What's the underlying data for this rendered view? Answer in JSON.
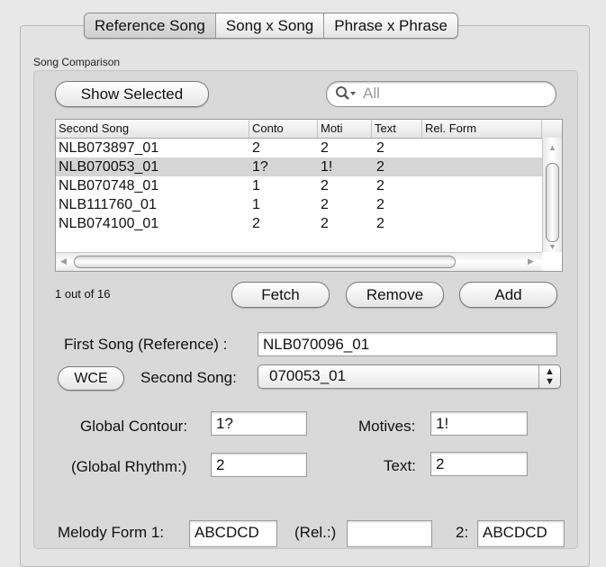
{
  "tabs": [
    {
      "label": "Reference Song",
      "selected": true
    },
    {
      "label": "Song x Song",
      "selected": false
    },
    {
      "label": "Phrase x Phrase",
      "selected": false
    }
  ],
  "group_label": "Song Comparison",
  "buttons": {
    "show_selected": "Show Selected",
    "fetch": "Fetch",
    "remove": "Remove",
    "add": "Add",
    "wce": "WCE"
  },
  "search": {
    "icon": "magnifier-dropdown-icon",
    "placeholder": "All"
  },
  "table": {
    "columns": [
      "Second Song",
      "Conto",
      "Moti",
      "Text",
      "Rel. Form"
    ],
    "rows": [
      {
        "song": "NLB073897_01",
        "conto": "2",
        "moti": "2",
        "text": "2",
        "rel": "",
        "selected": false
      },
      {
        "song": "NLB070053_01",
        "conto": "1?",
        "moti": "1!",
        "text": "2",
        "rel": "",
        "selected": true
      },
      {
        "song": "NLB070748_01",
        "conto": "1",
        "moti": "2",
        "text": "2",
        "rel": "",
        "selected": false
      },
      {
        "song": "NLB111760_01",
        "conto": "1",
        "moti": "2",
        "text": "2",
        "rel": "",
        "selected": false
      },
      {
        "song": "NLB074100_01",
        "conto": "2",
        "moti": "2",
        "text": "2",
        "rel": "",
        "selected": false
      }
    ]
  },
  "count_text": "1 out of 16",
  "first_song": {
    "label": "First Song (Reference) :",
    "value": "NLB070096_01"
  },
  "second_song": {
    "label": "Second Song:",
    "value": "070053_01"
  },
  "global_contour": {
    "label": "Global Contour:",
    "value": "1?"
  },
  "motives": {
    "label": "Motives:",
    "value": "1!"
  },
  "global_rhythm": {
    "label": "(Global Rhythm:)",
    "value": "2"
  },
  "text_field": {
    "label": "Text:",
    "value": "2"
  },
  "melody_form": {
    "label1": "Melody Form 1:",
    "value1": "ABCDCD",
    "rel_label": "(Rel.:)",
    "rel_value": "",
    "label2": "2:",
    "value2": "ABCDCD"
  },
  "colors": {
    "selected_row": "#d5d5d5",
    "background": "#e8e8e8"
  }
}
